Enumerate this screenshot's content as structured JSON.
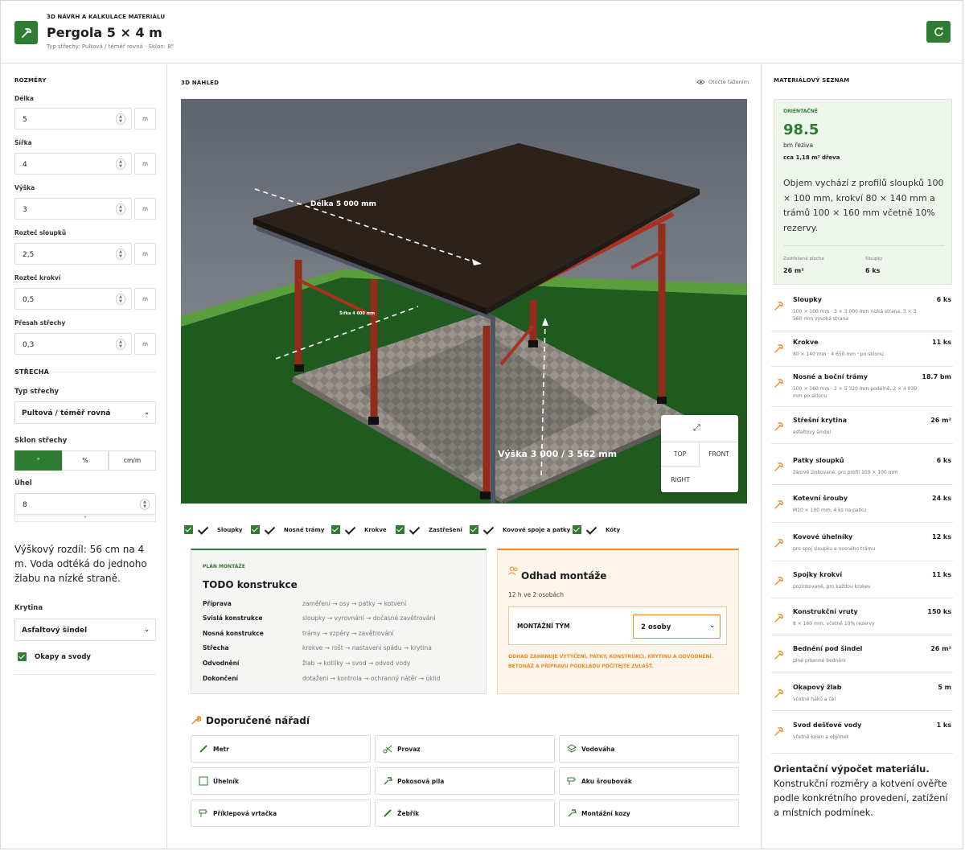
{
  "header": {
    "kicker": "3D NÁVRH A KALKULACE MATERIÁLU",
    "title": "Pergola 5 × 4 m",
    "subtitle": "Typ střechy: Pultová / téměř rovná · Sklon: 8°"
  },
  "left": {
    "section_dims": "ROZMĚRY",
    "fields": [
      {
        "label": "Délka",
        "value": "5",
        "unit": "m"
      },
      {
        "label": "Šířka",
        "value": "4",
        "unit": "m"
      },
      {
        "label": "Výška",
        "value": "3",
        "unit": "m"
      },
      {
        "label": "Rozteč sloupků",
        "value": "2,5",
        "unit": "m"
      },
      {
        "label": "Rozteč krokví",
        "value": "0,5",
        "unit": "m"
      },
      {
        "label": "Přesah střechy",
        "value": "0,3",
        "unit": "m"
      }
    ],
    "section_roof": "STŘECHA",
    "roof_type_label": "Typ střechy",
    "roof_type_value": "Pultová / téměř rovná",
    "slope_label": "Sklon střechy",
    "slope_options": [
      "°",
      "%",
      "cm/m"
    ],
    "angle_label": "Úhel",
    "angle_value": "8",
    "note": "Výškový rozdíl: 56 cm na 4 m. Voda odtéká do jednoho žlabu na nízké straně.",
    "covering_label": "Krytina",
    "covering_value": "Asfaltový šindel",
    "gutters_label": "Okapy a svody"
  },
  "preview": {
    "title": "3D NÁHLED",
    "rotate_hint": "Otočte tažením",
    "dim_length": "Délka 5 000 mm",
    "dim_width": "Šířka 4 000 mm",
    "dim_height": "Výška 3 000 / 3 562 mm",
    "cube": {
      "top": "TOP",
      "front": "FRONT",
      "right": "RIGHT"
    },
    "layers": [
      "Sloupky",
      "Nosné trámy",
      "Krokve",
      "Zastřešení",
      "Kovové spoje a patky",
      "Kóty"
    ]
  },
  "plan": {
    "kicker": "PLÁN MONTÁŽE",
    "title": "TODO konstrukce",
    "rows": [
      {
        "k": "Příprava",
        "v": "zaměření → osy → patky → kotvení"
      },
      {
        "k": "Svislá konstrukce",
        "v": "sloupky → vyrovnání → dočasné zavětrování"
      },
      {
        "k": "Nosná konstrukce",
        "v": "trámy → vzpěry → zavětrování"
      },
      {
        "k": "Střecha",
        "v": "krokve → rošt → nastavení spádu → krytina"
      },
      {
        "k": "Odvodnění",
        "v": "žlab → kotlíky → svod → odvod vody"
      },
      {
        "k": "Dokončení",
        "v": "dotažení → kontrola → ochranný nátěr → úklid"
      }
    ]
  },
  "montaz": {
    "title": "Odhad montáže",
    "hours": "12 h ve 2 osobách",
    "team_label": "MONTÁŽNÍ TÝM",
    "team_value": "2 osoby",
    "note": "ODHAD ZAHRNUJE VYTYČENÍ, PATKY, KONSTRUKCI, KRYTINU A ODVODNĚNÍ. BETONÁŽ A PŘÍPRAVU PODKLADU POČÍTEJTE ZVLÁŠŤ."
  },
  "tools": {
    "title": "Doporučené nářadí",
    "items": [
      {
        "label": "Metr",
        "icon": "tape-icon"
      },
      {
        "label": "Provaz",
        "icon": "scissors-icon"
      },
      {
        "label": "Vodováha",
        "icon": "level-icon"
      },
      {
        "label": "Úhelník",
        "icon": "square-icon"
      },
      {
        "label": "Pokosová pila",
        "icon": "saw-icon"
      },
      {
        "label": "Aku šroubovák",
        "icon": "drill-icon"
      },
      {
        "label": "Příklepová vrtačka",
        "icon": "drill-icon"
      },
      {
        "label": "Žebřík",
        "icon": "ladder-icon"
      },
      {
        "label": "Montážní kozy",
        "icon": "hammer-icon"
      }
    ]
  },
  "materials": {
    "title": "MATERIÁLOVÝ SEZNAM",
    "summary": {
      "kicker": "ORIENTAČNĚ",
      "value": "98.5",
      "unit": "bm řeziva",
      "volume": "cca 1,18 m³ dřeva",
      "desc": "Objem vychází z profilů sloupků 100 × 100 mm, krokví 80 × 140 mm a trámů 100 × 160 mm včetně 10% rezervy.",
      "area_label": "Zastřešená plocha",
      "area_value": "26 m²",
      "posts_label": "Sloupky",
      "posts_value": "6 ks"
    },
    "items": [
      {
        "name": "Sloupky",
        "qty": "6 ks",
        "desc": "100 × 100 mm · 3 × 3 000 mm nízká strana, 3 × 3 560 mm vysoká strana"
      },
      {
        "name": "Krokve",
        "qty": "11 ks",
        "desc": "80 × 140 mm · 4 650 mm · po sklonu"
      },
      {
        "name": "Nosné a boční trámy",
        "qty": "18.7 bm",
        "desc": "100 × 160 mm · 2 × 5 320 mm podélně, 2 × 4 039 mm po sklonu"
      },
      {
        "name": "Střešní krytina",
        "qty": "26 m²",
        "desc": "asfaltový šindel"
      },
      {
        "name": "Patky sloupků",
        "qty": "6 ks",
        "desc": "žárově zinkované, pro profil 100 × 100 mm"
      },
      {
        "name": "Kotevní šrouby",
        "qty": "24 ks",
        "desc": "M10 × 100 mm, 4 ks na patku"
      },
      {
        "name": "Kovové úhelníky",
        "qty": "12 ks",
        "desc": "pro spoj sloupku a nosného trámu"
      },
      {
        "name": "Spojky krokví",
        "qty": "11 ks",
        "desc": "pozinkované, pro každou krokev"
      },
      {
        "name": "Konstrukční vruty",
        "qty": "150 ks",
        "desc": "8 × 160 mm, včetně 10% rezervy"
      },
      {
        "name": "Bednění pod šindel",
        "qty": "26 m²",
        "desc": "plné prkenné bednění"
      },
      {
        "name": "Okapový žlab",
        "qty": "5 m",
        "desc": "včetně háků a čel"
      },
      {
        "name": "Svod dešťové vody",
        "qty": "1 ks",
        "desc": "včetně kolen a objímek"
      }
    ],
    "footer_title": "Orientační výpočet materiálu.",
    "footer_text": "Konstrukční rozměry a kotvení ověřte podle konkrétního provedení, zatížení a místních podmínek."
  },
  "colors": {
    "accent": "#2f7d32",
    "orange": "#ef8a24",
    "roof": "#2b221c",
    "wood": "#a8321f"
  }
}
